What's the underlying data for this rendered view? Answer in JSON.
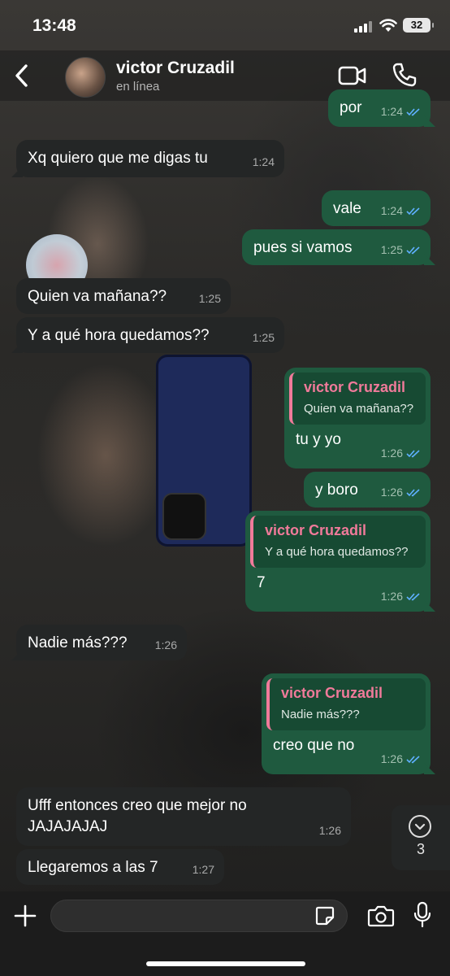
{
  "status_bar": {
    "time": "13:48",
    "battery": "32"
  },
  "header": {
    "contact_name": "victor Cruzadil",
    "contact_status": "en línea"
  },
  "messages": [
    {
      "dir": "out",
      "text": "por",
      "time": "1:24"
    },
    {
      "dir": "in",
      "text": "Xq quiero que me digas tu",
      "time": "1:24"
    },
    {
      "dir": "out",
      "text": "vale",
      "time": "1:24"
    },
    {
      "dir": "out",
      "text": "pues si vamos",
      "time": "1:25"
    },
    {
      "dir": "in",
      "text": "Quien va mañana??",
      "time": "1:25"
    },
    {
      "dir": "in",
      "text": "Y a qué hora quedamos??",
      "time": "1:25"
    },
    {
      "dir": "out",
      "quote_name": "victor Cruzadil",
      "quote_text": "Quien va mañana??",
      "text": "tu y yo",
      "time": "1:26"
    },
    {
      "dir": "out",
      "text": "y boro",
      "time": "1:26"
    },
    {
      "dir": "out",
      "quote_name": "victor Cruzadil",
      "quote_text": "Y a qué hora quedamos??",
      "text": "7",
      "time": "1:26"
    },
    {
      "dir": "in",
      "text": "Nadie más???",
      "time": "1:26"
    },
    {
      "dir": "out",
      "quote_name": "victor Cruzadil",
      "quote_text": "Nadie más???",
      "text": "creo que no",
      "time": "1:26"
    },
    {
      "dir": "in",
      "text": "Ufff entonces creo que mejor no",
      "text2": "JAJAJAJAJ",
      "time": "1:26"
    },
    {
      "dir": "in",
      "text": "Llegaremos a las 7",
      "time": "1:27"
    }
  ],
  "scroll_badge": {
    "count": "3"
  },
  "composer": {
    "placeholder": ""
  },
  "colors": {
    "outgoing": "#1f5a3f",
    "incoming": "#242626",
    "quote_accent": "#f07a9a",
    "read_ticks": "#5fb0ff"
  },
  "icons": [
    "back-chevron-icon",
    "video-call-icon",
    "phone-icon",
    "plus-icon",
    "sticker-icon",
    "camera-icon",
    "microphone-icon",
    "chevron-down-icon",
    "double-check-icon"
  ]
}
